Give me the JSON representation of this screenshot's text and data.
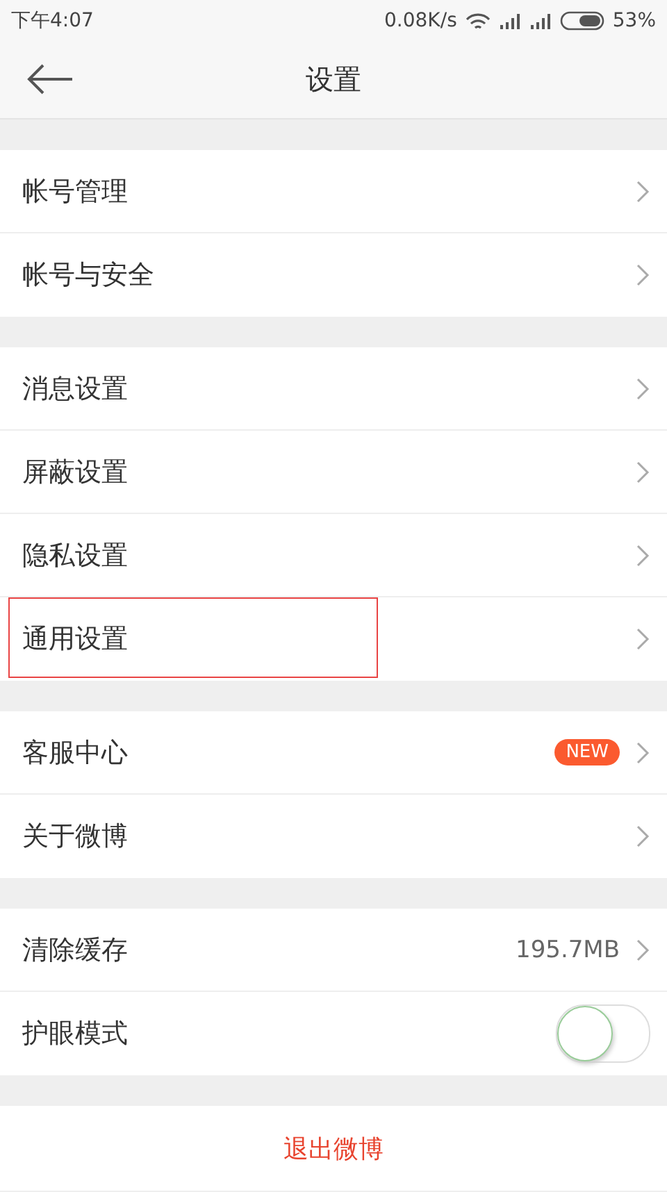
{
  "status_bar": {
    "time": "下午4:07",
    "speed": "0.08K/s",
    "battery": "53%"
  },
  "header": {
    "title": "设置"
  },
  "groups": [
    {
      "rows": [
        {
          "label": "帐号管理",
          "kind": "arrow",
          "highlighted": false
        },
        {
          "label": "帐号与安全",
          "kind": "arrow",
          "highlighted": false
        }
      ]
    },
    {
      "rows": [
        {
          "label": "消息设置",
          "kind": "arrow",
          "highlighted": false
        },
        {
          "label": "屏蔽设置",
          "kind": "arrow",
          "highlighted": false
        },
        {
          "label": "隐私设置",
          "kind": "arrow",
          "highlighted": false
        },
        {
          "label": "通用设置",
          "kind": "arrow",
          "highlighted": true
        }
      ]
    },
    {
      "rows": [
        {
          "label": "客服中心",
          "kind": "badge",
          "badge": "NEW",
          "highlighted": false
        },
        {
          "label": "关于微博",
          "kind": "arrow",
          "highlighted": false
        }
      ]
    },
    {
      "rows": [
        {
          "label": "清除缓存",
          "kind": "value",
          "value": "195.7MB",
          "highlighted": false
        },
        {
          "label": "护眼模式",
          "kind": "toggle",
          "on": false,
          "highlighted": false
        }
      ]
    }
  ],
  "logout": "退出微博"
}
